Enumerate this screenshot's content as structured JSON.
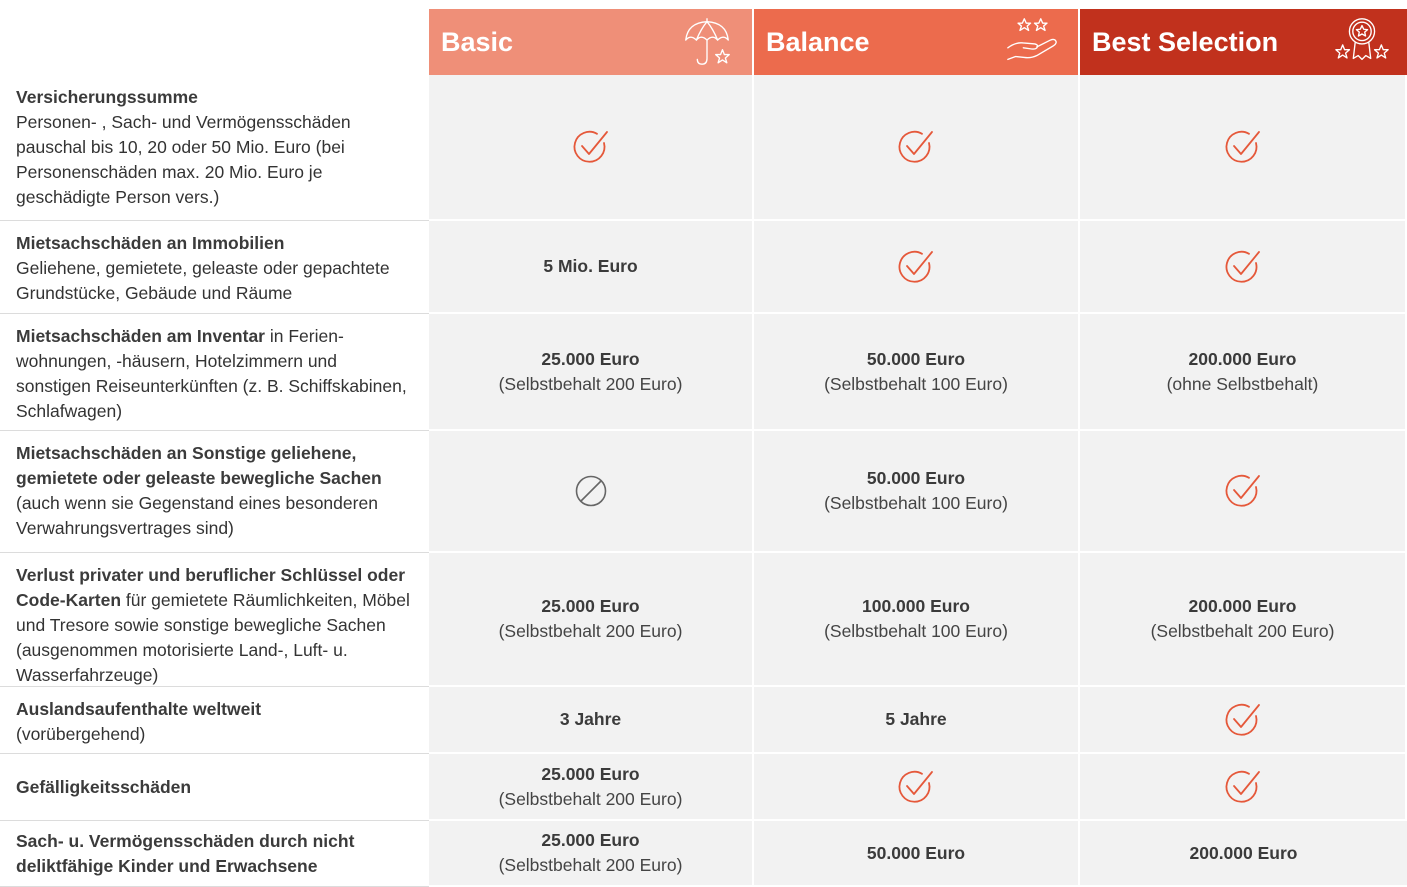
{
  "colors": {
    "basic": "#ef8f78",
    "balance": "#ec6b4d",
    "best_selection": "#c1311d",
    "check": "#e5583a",
    "not_included": "#666666"
  },
  "plans": [
    {
      "name": "Basic",
      "icon": "umbrella-star-icon"
    },
    {
      "name": "Balance",
      "icon": "hand-stars-icon"
    },
    {
      "name": "Best Selection",
      "icon": "award-stars-icon"
    }
  ],
  "rows": [
    {
      "title": "Versicherungssumme",
      "text": "Personen- , Sach- und Vermögensschäden pauschal bis 10, 20 oder 50 Mio. Euro (bei Personenschäden max. 20 Mio. Euro je geschädigte Person vers.)",
      "cells": [
        {
          "type": "check",
          "icon": "check-circle-icon"
        },
        {
          "type": "check",
          "icon": "check-circle-icon"
        },
        {
          "type": "check",
          "icon": "check-circle-icon"
        }
      ]
    },
    {
      "title": "Mietsachschäden an Immobilien",
      "text": "Geliehene, gemietete, geleaste oder gepach­tete Grundstücke, Gebäude und Räume",
      "cells": [
        {
          "type": "value",
          "value": "5 Mio. Euro"
        },
        {
          "type": "check",
          "icon": "check-circle-icon"
        },
        {
          "type": "check",
          "icon": "check-circle-icon"
        }
      ]
    },
    {
      "title": "Mietsachschäden am Inventar",
      "text": " in Ferien­wohnungen, -häusern, Hotelzimmern und sonstigen Reiseunterkünften (z. B. Schiffs­kabinen, Schlafwagen)",
      "cells": [
        {
          "type": "value",
          "value": "25.000 Euro",
          "sub": "(Selbstbehalt 200 Euro)"
        },
        {
          "type": "value",
          "value": "50.000 Euro",
          "sub": "(Selbstbehalt 100 Euro)"
        },
        {
          "type": "value",
          "value": "200.000 Euro",
          "sub": "(ohne Selbstbehalt)"
        }
      ]
    },
    {
      "title": "Mietsachschäden an Sonstige geliehene, gemietete oder geleaste bewegliche Sachen",
      "text": " (auch wenn sie Gegenstand eines besonderen Verwahrungsvertrages sind)",
      "cells": [
        {
          "type": "none",
          "icon": "not-included-icon"
        },
        {
          "type": "value",
          "value": "50.000 Euro",
          "sub": "(Selbstbehalt 100 Euro)"
        },
        {
          "type": "check",
          "icon": "check-circle-icon"
        }
      ]
    },
    {
      "title": "Verlust privater und beruflicher Schlüssel oder Code-Karten",
      "text": " für gemietete Räumlich­keiten, Möbel und Tresore sowie sonstige bewegliche Sachen (ausgenommen motori­sierte Land-, Luft- u. Wasserfahrzeuge)",
      "cells": [
        {
          "type": "value",
          "value": "25.000 Euro",
          "sub": "(Selbstbehalt 200 Euro)"
        },
        {
          "type": "value",
          "value": "100.000 Euro",
          "sub": "(Selbstbehalt 100 Euro)"
        },
        {
          "type": "value",
          "value": "200.000 Euro",
          "sub": "(Selbstbehalt 200 Euro)"
        }
      ]
    },
    {
      "title": "Auslandsaufenthalte weltweit",
      "text": "(vorübergehend)",
      "cells": [
        {
          "type": "value",
          "value": "3 Jahre"
        },
        {
          "type": "value",
          "value": "5 Jahre"
        },
        {
          "type": "check",
          "icon": "check-circle-icon"
        }
      ]
    },
    {
      "title": "Gefälligkeitsschäden",
      "text": "",
      "cells": [
        {
          "type": "value",
          "value": "25.000 Euro",
          "sub": "(Selbstbehalt 200 Euro)"
        },
        {
          "type": "check",
          "icon": "check-circle-icon"
        },
        {
          "type": "check",
          "icon": "check-circle-icon"
        }
      ]
    },
    {
      "title": "Sach- u. Vermögensschäden durch nicht deliktfähige Kinder und Erwachsene",
      "text": "",
      "cells": [
        {
          "type": "value",
          "value": "25.000 Euro",
          "sub": "(Selbstbehalt 200 Euro)"
        },
        {
          "type": "value",
          "value": "50.000 Euro"
        },
        {
          "type": "value",
          "value": "200.000 Euro"
        }
      ]
    }
  ]
}
